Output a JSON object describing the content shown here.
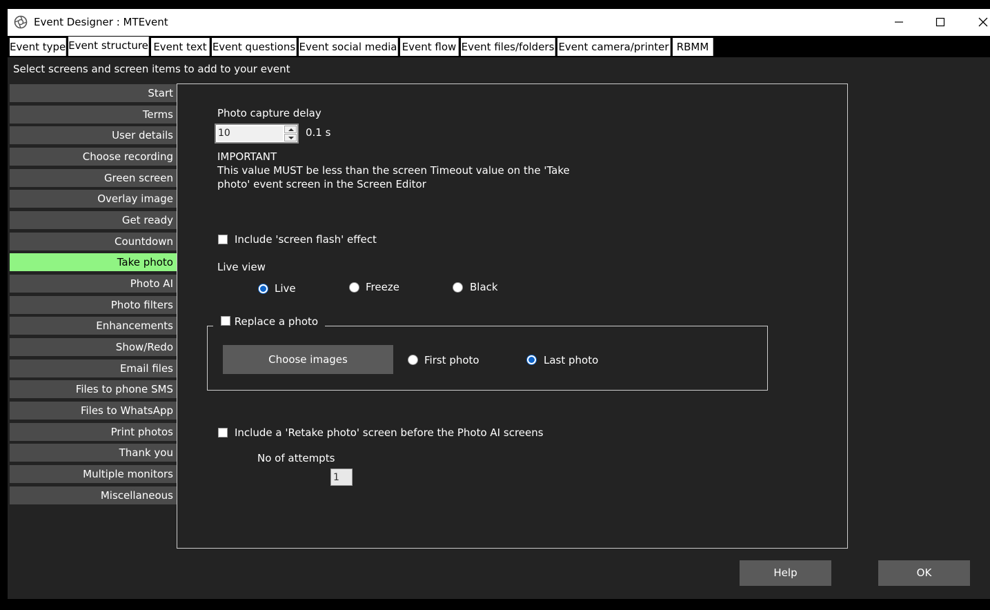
{
  "window": {
    "title": "Event Designer : MTEvent",
    "app_icon": "camera-aperture-icon",
    "controls": [
      "minimize-icon",
      "maximize-icon",
      "close-icon"
    ]
  },
  "tabs": [
    {
      "label": "Event type",
      "active": false
    },
    {
      "label": "Event structure",
      "active": true
    },
    {
      "label": "Event text",
      "active": false
    },
    {
      "label": "Event questions",
      "active": false
    },
    {
      "label": "Event social media",
      "active": false
    },
    {
      "label": "Event flow",
      "active": false
    },
    {
      "label": "Event files/folders",
      "active": false
    },
    {
      "label": "Event camera/printer",
      "active": false
    },
    {
      "label": "RBMM",
      "active": false
    }
  ],
  "hint": "Select screens and screen items to add to your event",
  "sidebar": {
    "items": [
      {
        "label": "Start"
      },
      {
        "label": "Terms"
      },
      {
        "label": "User details"
      },
      {
        "label": "Choose recording"
      },
      {
        "label": "Green screen"
      },
      {
        "label": "Overlay image"
      },
      {
        "label": "Get ready"
      },
      {
        "label": "Countdown"
      },
      {
        "label": "Take photo",
        "active": true
      },
      {
        "label": "Photo AI"
      },
      {
        "label": "Photo filters"
      },
      {
        "label": "Enhancements"
      },
      {
        "label": "Show/Redo"
      },
      {
        "label": "Email files"
      },
      {
        "label": "Files to phone SMS"
      },
      {
        "label": "Files to WhatsApp"
      },
      {
        "label": "Print photos"
      },
      {
        "label": "Thank you"
      },
      {
        "label": "Multiple monitors"
      },
      {
        "label": "Miscellaneous"
      }
    ],
    "active_color": "#90f483",
    "item_color": "#4b4b4b"
  },
  "panel": {
    "delay_label": "Photo capture delay",
    "delay_value": "10",
    "delay_unit": "0.1 s",
    "important_title": "IMPORTANT",
    "important_line1": "This value MUST be less than the screen Timeout value on the 'Take",
    "important_line2": "photo' event screen in the Screen Editor",
    "flash_label": "Include 'screen flash' effect",
    "flash_checked": false,
    "liveview_label": "Live view",
    "liveview_options": [
      {
        "label": "Live",
        "checked": true
      },
      {
        "label": "Freeze",
        "checked": false
      },
      {
        "label": "Black",
        "checked": false
      }
    ],
    "replace": {
      "label": "Replace a photo",
      "checked": false,
      "choose_button": "Choose images",
      "options": [
        {
          "label": "First photo",
          "checked": false
        },
        {
          "label": "Last photo",
          "checked": true
        }
      ]
    },
    "retake_label": "Include a 'Retake photo' screen before the Photo AI screens",
    "retake_checked": false,
    "attempts_label": "No of attempts",
    "attempts_value": "1"
  },
  "footer": {
    "help": "Help",
    "ok": "OK"
  },
  "colors": {
    "background": "#232323",
    "accent": "#0d63c8",
    "button": "#5a5a5a"
  }
}
